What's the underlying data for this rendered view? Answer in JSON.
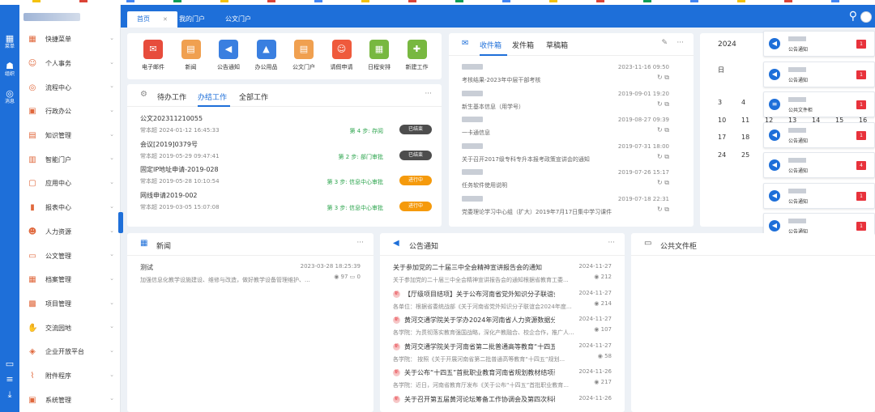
{
  "colors": {
    "primary": "#1e6fd9",
    "danger": "#e8323b",
    "done": "#4d4d4d",
    "progress": "#f59a0c"
  },
  "left_rail": [
    {
      "icon": "grid-icon",
      "label": "菜单"
    },
    {
      "icon": "org-icon",
      "label": "组织"
    },
    {
      "icon": "chat-icon",
      "label": "消息"
    }
  ],
  "sidebar": {
    "items": [
      {
        "label": "快捷菜单",
        "icon": "grid-icon",
        "glyph": "▦"
      },
      {
        "label": "个人事务",
        "icon": "user-icon",
        "glyph": "☺"
      },
      {
        "label": "流程中心",
        "icon": "flow-icon",
        "glyph": "◎"
      },
      {
        "label": "行政办公",
        "icon": "briefcase-icon",
        "glyph": "▣"
      },
      {
        "label": "知识管理",
        "icon": "book-icon",
        "glyph": "▤"
      },
      {
        "label": "智能门户",
        "icon": "portal-icon",
        "glyph": "▥"
      },
      {
        "label": "应用中心",
        "icon": "app-icon",
        "glyph": "▢"
      },
      {
        "label": "报表中心",
        "icon": "chart-icon",
        "glyph": "▮"
      },
      {
        "label": "人力资源",
        "icon": "people-icon",
        "glyph": "☻"
      },
      {
        "label": "公文管理",
        "icon": "folder-icon",
        "glyph": "▭"
      },
      {
        "label": "档案管理",
        "icon": "archive-icon",
        "glyph": "▦"
      },
      {
        "label": "项目管理",
        "icon": "project-icon",
        "glyph": "▩"
      },
      {
        "label": "交流园地",
        "icon": "hand-icon",
        "glyph": "✋"
      },
      {
        "label": "企业开放平台",
        "icon": "cube-icon",
        "glyph": "◈"
      },
      {
        "label": "附件程序",
        "icon": "clip-icon",
        "glyph": "⌇"
      },
      {
        "label": "系统管理",
        "icon": "settings-icon",
        "glyph": "▣"
      }
    ]
  },
  "tabs": [
    {
      "label": "首页"
    },
    {
      "label": "我的门户"
    },
    {
      "label": "公文门户"
    }
  ],
  "apps": [
    {
      "label": "电子邮件",
      "icon": "mail-icon",
      "glyph": "✉",
      "color": "#e74c3c"
    },
    {
      "label": "新闻",
      "icon": "news-icon",
      "glyph": "▤",
      "color": "#f0a050"
    },
    {
      "label": "公告通知",
      "icon": "speaker-icon",
      "glyph": "◀",
      "color": "#3a7fe0"
    },
    {
      "label": "办公用品",
      "icon": "supplies-icon",
      "glyph": "▲",
      "color": "#3a7fe0"
    },
    {
      "label": "公文门户",
      "icon": "doc-icon",
      "glyph": "▤",
      "color": "#f0a050"
    },
    {
      "label": "请假申请",
      "icon": "leave-icon",
      "glyph": "☺",
      "color": "#ef5a3c"
    },
    {
      "label": "日程安排",
      "icon": "calendar-icon",
      "glyph": "▦",
      "color": "#78b840"
    },
    {
      "label": "新建工作",
      "icon": "new-work-icon",
      "glyph": "✚",
      "color": "#78b840"
    }
  ],
  "work": {
    "tabs": [
      "待办工作",
      "办结工作",
      "全部工作"
    ],
    "items": [
      {
        "title": "公文202311210055",
        "meta": "常本超   2024-01-12 16:45:33",
        "step": "第 4 步: 存阅",
        "status": "已结束",
        "kind": "done"
      },
      {
        "title": "会议[2019]0379号",
        "meta": "常本超   2019-05-29 09:47:41",
        "step": "第 2 步: 部门审批",
        "status": "已结束",
        "kind": "done"
      },
      {
        "title": "固定IP地址申请-2019-028",
        "meta": "常本超   2019-05-28 10:10:54",
        "step": "第 3 步: 信息中心审批",
        "status": "进行中",
        "kind": "progress"
      },
      {
        "title": "网线申请2019-002",
        "meta": "常本超   2019-03-05 15:07:08",
        "step": "第 3 步: 信息中心审批",
        "status": "进行中",
        "kind": "progress"
      }
    ]
  },
  "mail": {
    "tabs": [
      "收件箱",
      "发件箱",
      "草稿箱"
    ],
    "items": [
      {
        "date": "2023-11-16 09:50",
        "title": "考核结果-2023年中层干部考核"
      },
      {
        "date": "2019-09-01 19:20",
        "title": "新生基本信息（用学号）"
      },
      {
        "date": "2019-08-27 09:39",
        "title": "一卡通信息"
      },
      {
        "date": "2019-07-31 18:00",
        "title": "关于召开2017级专科专升本报考政策宣讲会的通知"
      },
      {
        "date": "2019-07-26 15:17",
        "title": "任务软件使用说明"
      },
      {
        "date": "2019-07-18 22:31",
        "title": "党委理论学习中心组（扩大）2019年7月17日集中学习课件"
      }
    ]
  },
  "calendar": {
    "year": "2024",
    "weekday": "日",
    "rows": [
      [
        "3",
        "4"
      ],
      [
        "10",
        "11",
        "12",
        "13",
        "14",
        "15",
        "16"
      ],
      [
        "17",
        "18"
      ],
      [
        "24",
        "25"
      ]
    ]
  },
  "notice_popups": [
    {
      "label": "公告通知",
      "count": "1"
    },
    {
      "label": "公告通知",
      "count": "1"
    },
    {
      "label": "公共文件柜",
      "count": "1"
    },
    {
      "label": "公告通知",
      "count": "1"
    },
    {
      "label": "公告通知",
      "count": "4"
    },
    {
      "label": "公告通知",
      "count": "1"
    },
    {
      "label": "公告通知",
      "count": "1"
    }
  ],
  "news": {
    "title": "新闻",
    "items": [
      {
        "title": "测试",
        "date": "2023-03-28 18:25:39",
        "summary": "加强信息化教学设施建设、维修与改造，做好教学设备管理维护、...",
        "views": "97",
        "comments": "0"
      }
    ]
  },
  "announcements": {
    "title": "公告通知",
    "items": [
      {
        "title": "关于参加党的二十届三中全会精神宣讲报告会的通知",
        "date": "2024-11-27",
        "summary": "关于参加党的二十届三中全会精神宣讲报告会的通知根据省教育工委...",
        "views": "212",
        "new": false
      },
      {
        "title": "【厅级项目结项】关于公布河南省党外知识分子联谊会20...",
        "date": "2024-11-27",
        "summary": "各单位：根据省委统战部《关于河南省党外知识分子联谊会2024年度...",
        "views": "214",
        "new": true
      },
      {
        "title": "黄河交通学院关于学办2024年河南省人力资源数据分析...",
        "date": "2024-11-27",
        "summary": "各学院：为贯彻落实教育强国战略，深化产教融合、校企合作，推广人...",
        "views": "107",
        "new": true
      },
      {
        "title": "黄河交通学院关于河南省第二批普通高等教育“十四五”...",
        "date": "2024-11-27",
        "summary": "各学院：  按照《关于开展河南省第二批普通高等教育“十四五”规划...",
        "views": "58",
        "new": true
      },
      {
        "title": "关于公布“十四五”首批职业教育河南省规划教材结项验...",
        "date": "2024-11-26",
        "summary": "各学院：近日，河南省教育厅发布《关于公布“十四五”首批职业教育...",
        "views": "217",
        "new": true
      },
      {
        "title": "关于召开第五届黄河论坛筹备工作协调会及第四次科研工...",
        "date": "2024-11-26",
        "summary": "",
        "views": "",
        "new": true
      }
    ]
  },
  "files": {
    "title": "公共文件柜"
  },
  "dots": "···"
}
